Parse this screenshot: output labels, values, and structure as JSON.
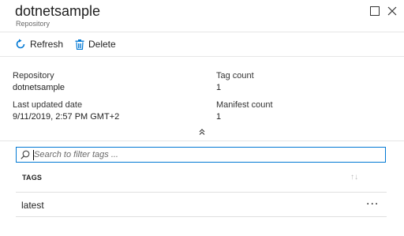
{
  "header": {
    "title": "dotnetsample",
    "subtitle": "Repository",
    "maximize_icon": "maximize-square-icon",
    "close_icon": "close-x-icon"
  },
  "toolbar": {
    "refresh_label": "Refresh",
    "refresh_icon": "refresh-icon",
    "delete_label": "Delete",
    "delete_icon": "trash-icon",
    "accent_color": "#0078d4"
  },
  "properties": {
    "repository_label": "Repository",
    "repository_value": "dotnetsample",
    "last_updated_label": "Last updated date",
    "last_updated_value": "9/11/2019, 2:57 PM GMT+2",
    "tag_count_label": "Tag count",
    "tag_count_value": "1",
    "manifest_count_label": "Manifest count",
    "manifest_count_value": "1",
    "collapse_icon": "double-chevron-up-icon"
  },
  "search": {
    "placeholder": "Search to filter tags ...",
    "value": "",
    "icon": "search-icon"
  },
  "table": {
    "header": "TAGS",
    "sort_icon": "sort-arrows-icon",
    "rows": [
      {
        "name": "latest",
        "more": "..."
      }
    ]
  }
}
